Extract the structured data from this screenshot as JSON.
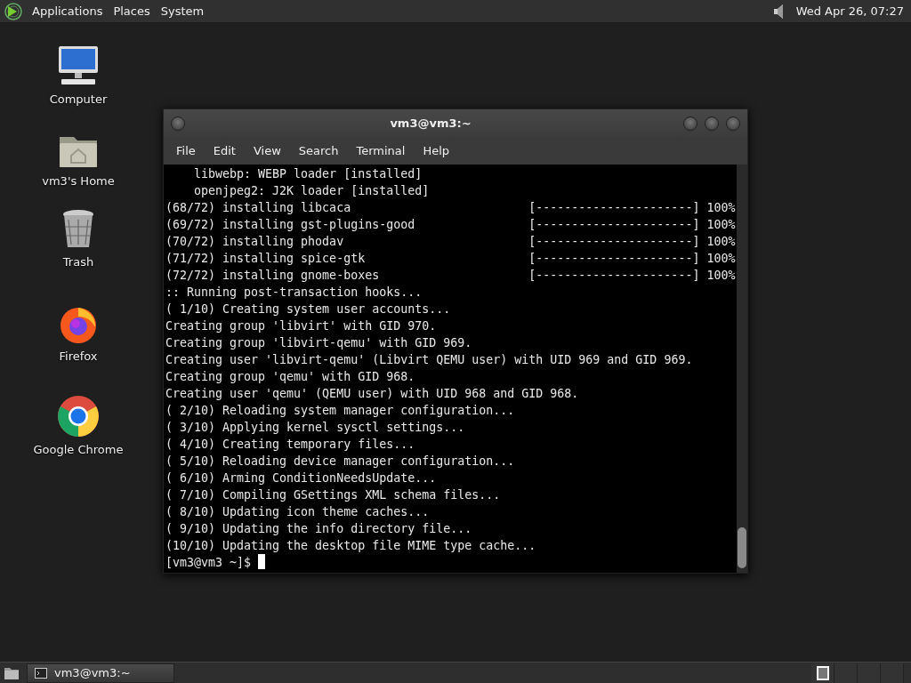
{
  "top_panel": {
    "menus": [
      "Applications",
      "Places",
      "System"
    ],
    "clock": "Wed Apr 26, 07:27"
  },
  "desktop_icons": [
    {
      "kind": "computer",
      "label": "Computer"
    },
    {
      "kind": "home",
      "label": "vm3's Home"
    },
    {
      "kind": "trash",
      "label": "Trash"
    },
    {
      "kind": "firefox",
      "label": "Firefox"
    },
    {
      "kind": "chrome",
      "label": "Google Chrome"
    }
  ],
  "window": {
    "title": "vm3@vm3:~",
    "menu": [
      "File",
      "Edit",
      "View",
      "Search",
      "Terminal",
      "Help"
    ],
    "lines": [
      {
        "kind": "text",
        "text": "    libwebp: WEBP loader [installed]"
      },
      {
        "kind": "text",
        "text": "    openjpeg2: J2K loader [installed]"
      },
      {
        "kind": "progress",
        "text": "(68/72) installing libcaca",
        "bar": "[----------------------]",
        "percent": "100%"
      },
      {
        "kind": "progress",
        "text": "(69/72) installing gst-plugins-good",
        "bar": "[----------------------]",
        "percent": "100%"
      },
      {
        "kind": "progress",
        "text": "(70/72) installing phodav",
        "bar": "[----------------------]",
        "percent": "100%"
      },
      {
        "kind": "progress",
        "text": "(71/72) installing spice-gtk",
        "bar": "[----------------------]",
        "percent": "100%"
      },
      {
        "kind": "progress",
        "text": "(72/72) installing gnome-boxes",
        "bar": "[----------------------]",
        "percent": "100%"
      },
      {
        "kind": "text",
        "text": ":: Running post-transaction hooks..."
      },
      {
        "kind": "text",
        "text": "( 1/10) Creating system user accounts..."
      },
      {
        "kind": "text",
        "text": "Creating group 'libvirt' with GID 970."
      },
      {
        "kind": "text",
        "text": "Creating group 'libvirt-qemu' with GID 969."
      },
      {
        "kind": "text",
        "text": "Creating user 'libvirt-qemu' (Libvirt QEMU user) with UID 969 and GID 969."
      },
      {
        "kind": "text",
        "text": "Creating group 'qemu' with GID 968."
      },
      {
        "kind": "text",
        "text": "Creating user 'qemu' (QEMU user) with UID 968 and GID 968."
      },
      {
        "kind": "text",
        "text": "( 2/10) Reloading system manager configuration..."
      },
      {
        "kind": "text",
        "text": "( 3/10) Applying kernel sysctl settings..."
      },
      {
        "kind": "text",
        "text": "( 4/10) Creating temporary files..."
      },
      {
        "kind": "text",
        "text": "( 5/10) Reloading device manager configuration..."
      },
      {
        "kind": "text",
        "text": "( 6/10) Arming ConditionNeedsUpdate..."
      },
      {
        "kind": "text",
        "text": "( 7/10) Compiling GSettings XML schema files..."
      },
      {
        "kind": "text",
        "text": "( 8/10) Updating icon theme caches..."
      },
      {
        "kind": "text",
        "text": "( 9/10) Updating the info directory file..."
      },
      {
        "kind": "text",
        "text": "(10/10) Updating the desktop file MIME type cache..."
      },
      {
        "kind": "prompt",
        "text": "[vm3@vm3 ~]$ "
      }
    ]
  },
  "taskbar": {
    "windows": [
      {
        "title": "vm3@vm3:~"
      }
    ],
    "workspaces": [
      {
        "selected": true
      },
      {
        "selected": false
      },
      {
        "selected": false
      },
      {
        "selected": false
      }
    ]
  }
}
